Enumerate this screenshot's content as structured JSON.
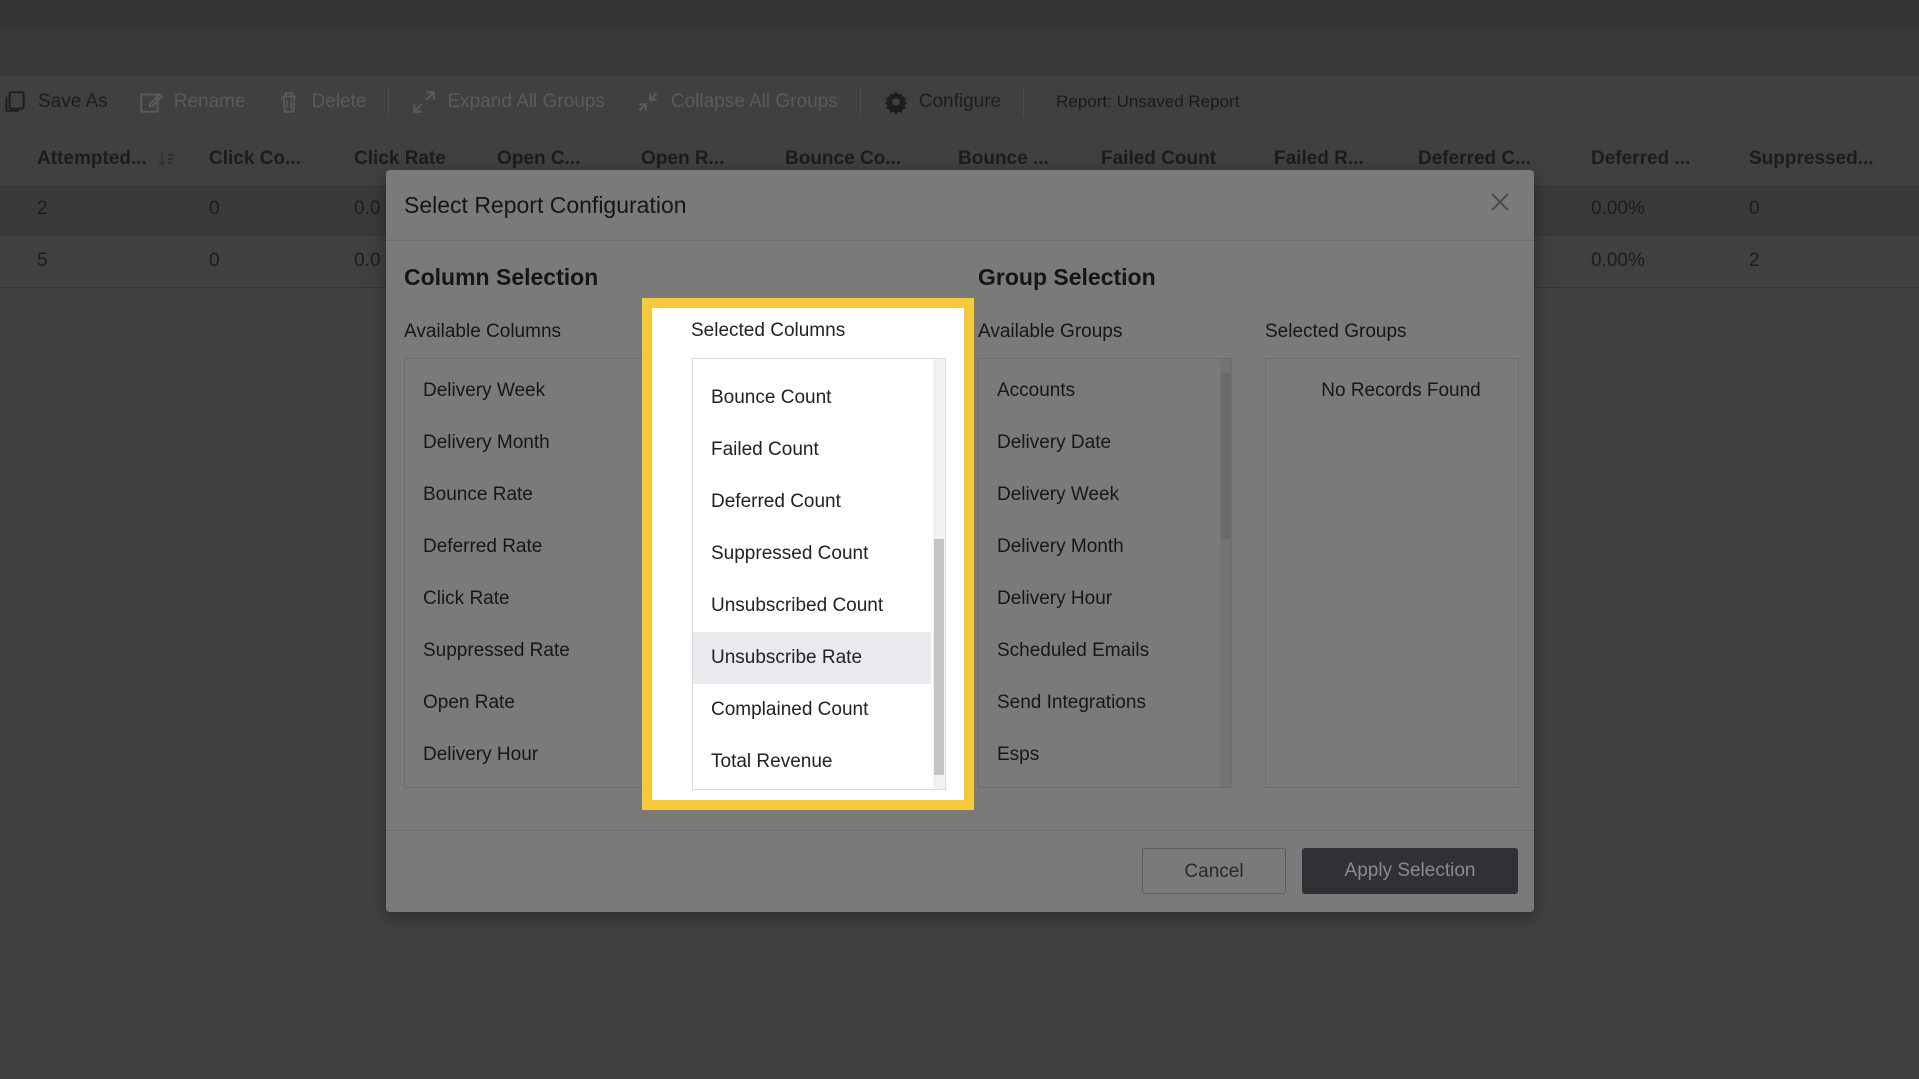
{
  "toolbar": {
    "save_as": "Save As",
    "rename": "Rename",
    "delete": "Delete",
    "expand_all": "Expand All Groups",
    "collapse_all": "Collapse All Groups",
    "configure": "Configure",
    "report_label": "Report: Unsaved Report"
  },
  "grid": {
    "headers": [
      "Attempted...",
      "Click Co...",
      "Click Rate",
      "Open C...",
      "Open R...",
      "Bounce Co...",
      "Bounce ...",
      "Failed Count",
      "Failed R...",
      "Deferred C...",
      "Deferred ...",
      "Suppressed..."
    ],
    "rows": [
      {
        "attempted": "2",
        "click_count": "0",
        "click_rate": "0.0",
        "deferred_rate": "0.00%",
        "suppressed": "0"
      },
      {
        "attempted": "5",
        "click_count": "0",
        "click_rate": "0.0",
        "deferred_rate": "0.00%",
        "suppressed": "2"
      }
    ]
  },
  "modal": {
    "title": "Select Report Configuration",
    "column_section": "Column Selection",
    "group_section": "Group Selection",
    "available_columns_label": "Available Columns",
    "selected_columns_label": "Selected Columns",
    "available_groups_label": "Available Groups",
    "selected_groups_label": "Selected Groups",
    "available_columns": [
      "Delivery Week",
      "Delivery Month",
      "Bounce Rate",
      "Deferred Rate",
      "Click Rate",
      "Suppressed Rate",
      "Open Rate",
      "Delivery Hour"
    ],
    "selected_columns": [
      "Bounce Count",
      "Failed Count",
      "Deferred Count",
      "Suppressed Count",
      "Unsubscribed Count",
      "Unsubscribe Rate",
      "Complained Count",
      "Total Revenue"
    ],
    "selected_columns_highlighted": "Unsubscribe Rate",
    "available_groups": [
      "Accounts",
      "Delivery Date",
      "Delivery Week",
      "Delivery Month",
      "Delivery Hour",
      "Scheduled Emails",
      "Send Integrations",
      "Esps"
    ],
    "selected_groups_empty": "No Records Found",
    "cancel": "Cancel",
    "apply": "Apply Selection"
  },
  "colors": {
    "highlight_border": "#f5c93a",
    "overlay_bg": "#414141",
    "apply_button": "#2f3134"
  }
}
